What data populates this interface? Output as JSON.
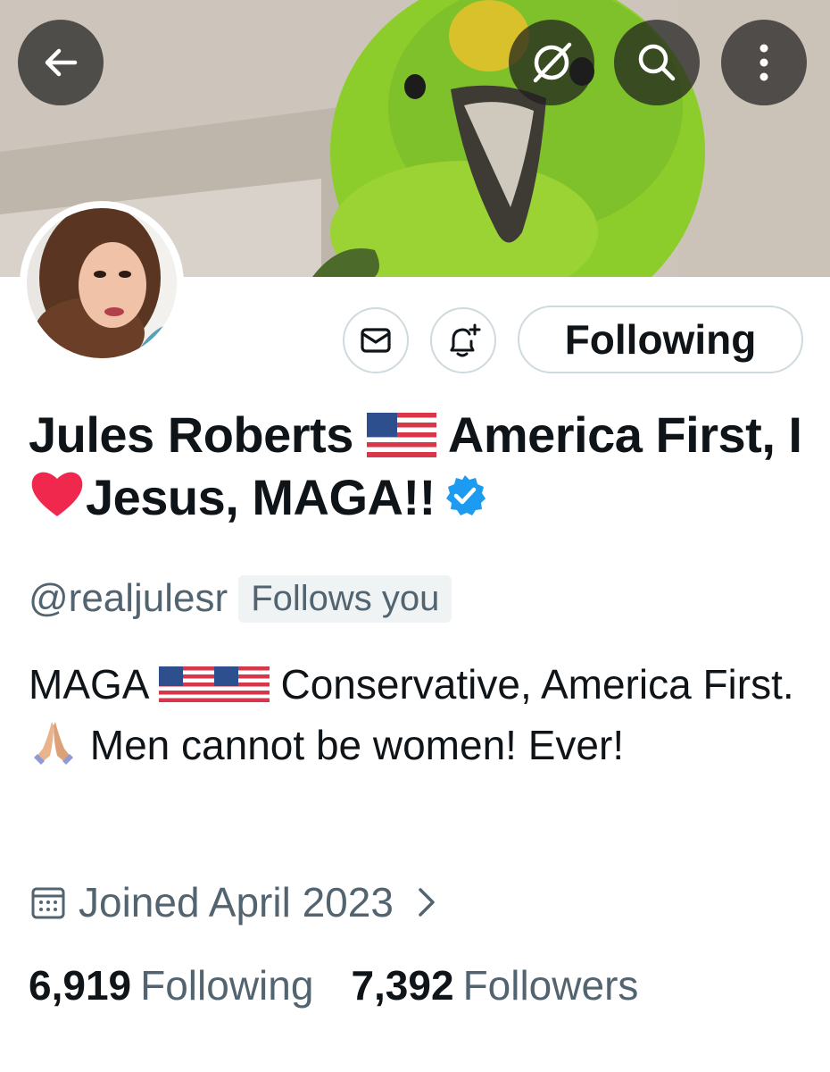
{
  "header": {
    "back_icon": "arrow-left-icon",
    "grok_icon": "grok-icon",
    "search_icon": "search-icon",
    "more_icon": "more-vertical-icon",
    "banner_subject": "green parrot"
  },
  "actions": {
    "message_icon": "envelope-icon",
    "notify_icon": "bell-plus-icon",
    "following_label": "Following"
  },
  "profile": {
    "name_part1": "Jules Roberts ",
    "name_part2": " America First, I",
    "name_part3": "Jesus, MAGA!!",
    "handle": "@realjulesr",
    "follows_you": "Follows you",
    "bio_part1": "MAGA ",
    "bio_part2": " Conservative, America First. ",
    "bio_part3": " Men cannot be women! Ever!",
    "joined": "Joined April 2023",
    "following_count": "6,919",
    "following_label": "Following",
    "followers_count": "7,392",
    "followers_label": "Followers"
  },
  "colors": {
    "text_primary": "#0f1419",
    "text_secondary": "#536471",
    "verified_blue": "#1d9bf0",
    "border": "#cfd9de"
  }
}
